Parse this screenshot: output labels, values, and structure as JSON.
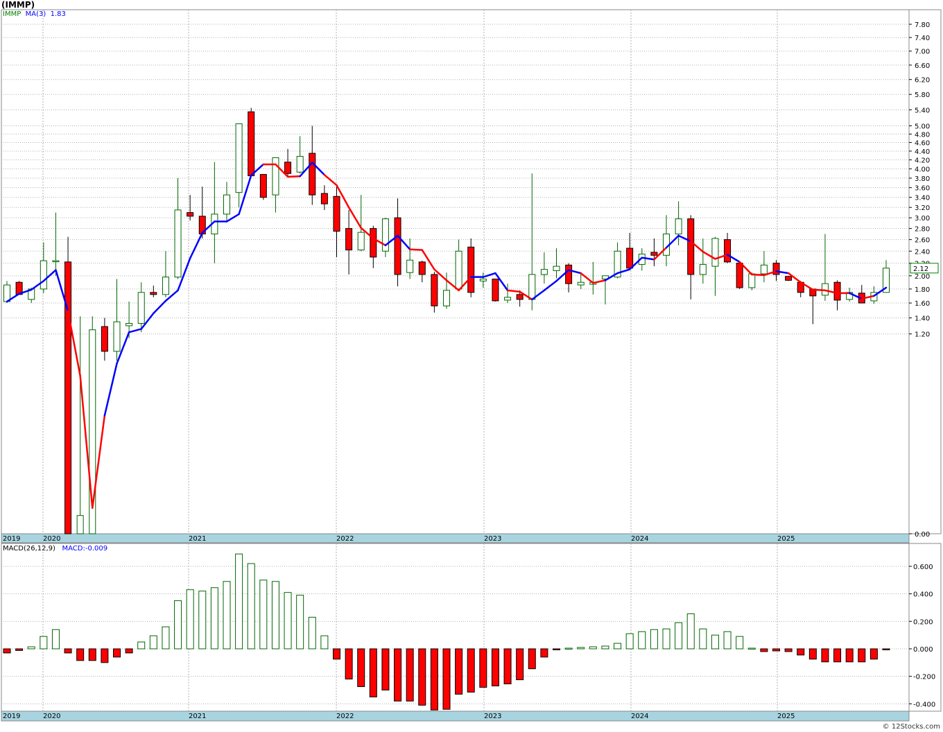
{
  "title": "(IMMP)",
  "legend_price": {
    "symbol": "IMMP",
    "ma_label": "MA(3)",
    "ma_value": "1.83"
  },
  "legend_macd": {
    "label": "MACD(26,12,9)",
    "value_label": "MACD:-0.009"
  },
  "credit": "© 12Stocks.com",
  "colors": {
    "up": "#ffffff",
    "up_border": "#006600",
    "down": "#ff0000",
    "ma_up": "#0000ff",
    "ma_down": "#ff0000",
    "axis_band": "#a8d4e0",
    "grid": "#b0b0b0",
    "badge_border": "#008000"
  },
  "chart_data": [
    {
      "type": "candlestick",
      "scale": "sqrt",
      "ylim": [
        0,
        8.0
      ],
      "y_ticks": [
        "0.00",
        "1.20",
        "1.40",
        "1.60",
        "1.80",
        "2.00",
        "2.20",
        "2.40",
        "2.60",
        "2.80",
        "3.00",
        "3.20",
        "3.40",
        "3.60",
        "3.80",
        "4.00",
        "4.20",
        "4.40",
        "4.60",
        "4.80",
        "5.00",
        "5.40",
        "5.80",
        "6.20",
        "6.60",
        "7.00",
        "7.40",
        "7.80"
      ],
      "x_labels": [
        "2019",
        "2020",
        "2021",
        "2022",
        "2023",
        "2024",
        "2025"
      ],
      "last_price": "2.12",
      "candles": [
        {
          "o": 1.62,
          "h": 1.92,
          "l": 1.6,
          "c": 1.86
        },
        {
          "o": 1.9,
          "h": 1.92,
          "l": 1.72,
          "c": 1.72
        },
        {
          "o": 1.65,
          "h": 1.82,
          "l": 1.6,
          "c": 1.8
        },
        {
          "o": 1.8,
          "h": 2.55,
          "l": 1.74,
          "c": 2.24
        },
        {
          "o": 2.24,
          "h": 3.1,
          "l": 2.0,
          "c": 2.24
        },
        {
          "o": 2.22,
          "h": 2.65,
          "l": 0.0,
          "c": 0.0
        },
        {
          "o": 0.0,
          "h": 1.42,
          "l": 0.0,
          "c": 0.01
        },
        {
          "o": 0.0,
          "h": 1.42,
          "l": 0.0,
          "c": 1.25
        },
        {
          "o": 1.29,
          "h": 1.4,
          "l": 0.9,
          "c": 1.0
        },
        {
          "o": 1.0,
          "h": 1.95,
          "l": 0.9,
          "c": 1.35
        },
        {
          "o": 1.3,
          "h": 1.62,
          "l": 1.15,
          "c": 1.33
        },
        {
          "o": 1.33,
          "h": 1.9,
          "l": 1.22,
          "c": 1.75
        },
        {
          "o": 1.75,
          "h": 1.85,
          "l": 1.68,
          "c": 1.72
        },
        {
          "o": 1.72,
          "h": 2.4,
          "l": 1.68,
          "c": 1.98
        },
        {
          "o": 1.98,
          "h": 3.8,
          "l": 1.95,
          "c": 3.15
        },
        {
          "o": 3.1,
          "h": 3.45,
          "l": 2.95,
          "c": 3.03
        },
        {
          "o": 3.03,
          "h": 3.62,
          "l": 2.62,
          "c": 2.7
        },
        {
          "o": 2.7,
          "h": 4.15,
          "l": 2.2,
          "c": 3.07
        },
        {
          "o": 3.07,
          "h": 3.72,
          "l": 2.95,
          "c": 3.45
        },
        {
          "o": 3.5,
          "h": 4.1,
          "l": 3.2,
          "c": 5.05
        },
        {
          "o": 5.35,
          "h": 5.45,
          "l": 3.85,
          "c": 3.85
        },
        {
          "o": 3.88,
          "h": 3.88,
          "l": 3.35,
          "c": 3.4
        },
        {
          "o": 3.45,
          "h": 4.25,
          "l": 3.1,
          "c": 4.25
        },
        {
          "o": 4.15,
          "h": 4.45,
          "l": 3.85,
          "c": 3.9
        },
        {
          "o": 3.93,
          "h": 4.75,
          "l": 3.9,
          "c": 4.28
        },
        {
          "o": 4.35,
          "h": 5.0,
          "l": 3.25,
          "c": 3.45
        },
        {
          "o": 3.48,
          "h": 3.65,
          "l": 3.15,
          "c": 3.27
        },
        {
          "o": 3.42,
          "h": 3.62,
          "l": 2.3,
          "c": 2.75
        },
        {
          "o": 2.8,
          "h": 3.15,
          "l": 2.02,
          "c": 2.42
        },
        {
          "o": 2.42,
          "h": 3.45,
          "l": 2.4,
          "c": 2.73
        },
        {
          "o": 2.8,
          "h": 2.85,
          "l": 2.12,
          "c": 2.3
        },
        {
          "o": 2.4,
          "h": 3.0,
          "l": 2.3,
          "c": 2.98
        },
        {
          "o": 3.0,
          "h": 3.38,
          "l": 1.84,
          "c": 2.02
        },
        {
          "o": 2.05,
          "h": 2.62,
          "l": 1.95,
          "c": 2.25
        },
        {
          "o": 2.22,
          "h": 2.24,
          "l": 1.9,
          "c": 2.02
        },
        {
          "o": 2.02,
          "h": 2.06,
          "l": 1.47,
          "c": 1.56
        },
        {
          "o": 1.56,
          "h": 2.05,
          "l": 1.52,
          "c": 1.78
        },
        {
          "o": 1.8,
          "h": 2.6,
          "l": 1.78,
          "c": 2.4
        },
        {
          "o": 2.47,
          "h": 2.62,
          "l": 1.68,
          "c": 1.75
        },
        {
          "o": 1.92,
          "h": 2.05,
          "l": 1.82,
          "c": 1.95
        },
        {
          "o": 1.95,
          "h": 1.95,
          "l": 1.62,
          "c": 1.63
        },
        {
          "o": 1.64,
          "h": 1.88,
          "l": 1.6,
          "c": 1.68
        },
        {
          "o": 1.72,
          "h": 1.78,
          "l": 1.55,
          "c": 1.65
        },
        {
          "o": 1.65,
          "h": 3.9,
          "l": 1.5,
          "c": 2.02
        },
        {
          "o": 2.02,
          "h": 2.38,
          "l": 1.88,
          "c": 2.1
        },
        {
          "o": 2.08,
          "h": 2.45,
          "l": 1.96,
          "c": 2.15
        },
        {
          "o": 2.17,
          "h": 2.2,
          "l": 1.75,
          "c": 1.88
        },
        {
          "o": 1.86,
          "h": 2.05,
          "l": 1.8,
          "c": 1.9
        },
        {
          "o": 1.87,
          "h": 2.22,
          "l": 1.72,
          "c": 1.9
        },
        {
          "o": 1.95,
          "h": 2.0,
          "l": 1.58,
          "c": 2.0
        },
        {
          "o": 1.98,
          "h": 2.55,
          "l": 1.96,
          "c": 2.4
        },
        {
          "o": 2.45,
          "h": 2.72,
          "l": 2.1,
          "c": 2.12
        },
        {
          "o": 2.18,
          "h": 2.45,
          "l": 2.08,
          "c": 2.35
        },
        {
          "o": 2.38,
          "h": 2.62,
          "l": 2.15,
          "c": 2.33
        },
        {
          "o": 2.33,
          "h": 3.05,
          "l": 2.15,
          "c": 2.7
        },
        {
          "o": 2.7,
          "h": 3.32,
          "l": 2.5,
          "c": 2.98
        },
        {
          "o": 2.98,
          "h": 3.05,
          "l": 1.65,
          "c": 2.02
        },
        {
          "o": 2.02,
          "h": 2.62,
          "l": 1.88,
          "c": 2.18
        },
        {
          "o": 2.15,
          "h": 2.65,
          "l": 1.7,
          "c": 2.62
        },
        {
          "o": 2.6,
          "h": 2.72,
          "l": 2.2,
          "c": 2.22
        },
        {
          "o": 2.2,
          "h": 2.22,
          "l": 1.8,
          "c": 1.82
        },
        {
          "o": 1.82,
          "h": 2.05,
          "l": 1.78,
          "c": 2.03
        },
        {
          "o": 2.03,
          "h": 2.4,
          "l": 1.9,
          "c": 2.17
        },
        {
          "o": 2.2,
          "h": 2.25,
          "l": 1.92,
          "c": 2.02
        },
        {
          "o": 1.99,
          "h": 2.0,
          "l": 1.92,
          "c": 1.93
        },
        {
          "o": 1.9,
          "h": 1.92,
          "l": 1.68,
          "c": 1.75
        },
        {
          "o": 1.8,
          "h": 1.8,
          "l": 1.32,
          "c": 1.7
        },
        {
          "o": 1.71,
          "h": 2.7,
          "l": 1.63,
          "c": 1.88
        },
        {
          "o": 1.9,
          "h": 1.93,
          "l": 1.5,
          "c": 1.64
        },
        {
          "o": 1.65,
          "h": 1.82,
          "l": 1.62,
          "c": 1.75
        },
        {
          "o": 1.74,
          "h": 1.86,
          "l": 1.6,
          "c": 1.6
        },
        {
          "o": 1.63,
          "h": 1.84,
          "l": 1.59,
          "c": 1.75
        },
        {
          "o": 1.75,
          "h": 2.25,
          "l": 1.75,
          "c": 2.12
        }
      ],
      "ma3": [
        1.62,
        1.73,
        1.79,
        1.92,
        2.09,
        1.49,
        0.75,
        0.02,
        0.42,
        0.87,
        1.22,
        1.26,
        1.46,
        1.63,
        1.78,
        2.28,
        2.72,
        2.93,
        2.93,
        3.07,
        3.86,
        4.1,
        4.1,
        3.83,
        3.84,
        4.14,
        3.87,
        3.65,
        3.2,
        2.81,
        2.62,
        2.5,
        2.67,
        2.43,
        2.42,
        2.1,
        1.93,
        1.78,
        1.98,
        1.98,
        2.04,
        1.78,
        1.76,
        1.65,
        1.78,
        1.92,
        2.09,
        2.04,
        1.89,
        1.93,
        2.04,
        2.1,
        2.29,
        2.26,
        2.46,
        2.67,
        2.57,
        2.39,
        2.27,
        2.34,
        2.22,
        2.02,
        2.01,
        2.07,
        2.04,
        1.9,
        1.79,
        1.78,
        1.74,
        1.74,
        1.66,
        1.7,
        1.82
      ],
      "ma3_colors": [
        "u",
        "u",
        "u",
        "u",
        "u",
        "d",
        "d",
        "d",
        "u",
        "u",
        "u",
        "u",
        "u",
        "u",
        "u",
        "u",
        "u",
        "u",
        "u",
        "u",
        "u",
        "d",
        "d",
        "d",
        "u",
        "u",
        "d",
        "d",
        "d",
        "d",
        "d",
        "u",
        "u",
        "d",
        "d",
        "d",
        "d",
        "d",
        "u",
        "u",
        "u",
        "d",
        "d",
        "u",
        "u",
        "u",
        "u",
        "d",
        "d",
        "u",
        "u",
        "u",
        "u",
        "d",
        "u",
        "u",
        "d",
        "d",
        "d",
        "u",
        "d",
        "d",
        "d",
        "u",
        "d",
        "d",
        "d",
        "d",
        "d",
        "u",
        "d",
        "u",
        "u"
      ],
      "macd_legend_scale_note": ""
    },
    {
      "type": "bar",
      "ylim": [
        -0.45,
        0.72
      ],
      "y_ticks": [
        "-0.400",
        "-0.200",
        "0.000",
        "0.200",
        "0.400",
        "0.600"
      ],
      "x_labels": [
        "2019",
        "2020",
        "2021",
        "2022",
        "2023",
        "2024",
        "2025"
      ],
      "values": [
        -0.03,
        -0.012,
        0.015,
        0.09,
        0.14,
        -0.03,
        -0.085,
        -0.085,
        -0.1,
        -0.06,
        -0.03,
        0.05,
        0.095,
        0.16,
        0.35,
        0.43,
        0.42,
        0.445,
        0.49,
        0.69,
        0.62,
        0.5,
        0.49,
        0.41,
        0.39,
        0.23,
        0.095,
        -0.075,
        -0.22,
        -0.275,
        -0.35,
        -0.3,
        -0.38,
        -0.38,
        -0.41,
        -0.445,
        -0.44,
        -0.33,
        -0.315,
        -0.28,
        -0.27,
        -0.255,
        -0.225,
        -0.145,
        -0.06,
        -0.005,
        0.005,
        0.01,
        0.015,
        0.02,
        0.04,
        0.11,
        0.125,
        0.14,
        0.145,
        0.19,
        0.255,
        0.145,
        0.1,
        0.125,
        0.09,
        0.005,
        -0.02,
        -0.015,
        -0.02,
        -0.045,
        -0.075,
        -0.095,
        -0.095,
        -0.095,
        -0.095,
        -0.075,
        -0.005
      ]
    }
  ]
}
